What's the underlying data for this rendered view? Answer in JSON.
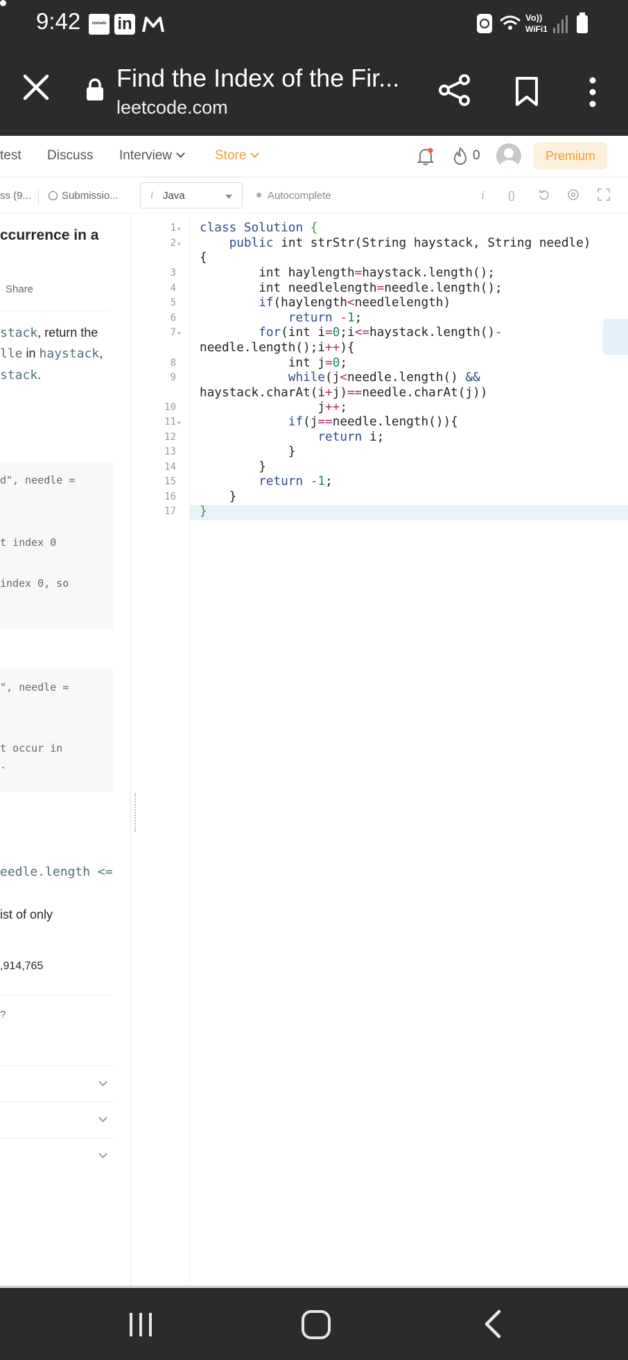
{
  "status_bar": {
    "time": "9:42",
    "zomato_label": "zomato",
    "linkedin_label": "in",
    "signal_label_1": "Vo))",
    "signal_label_2": "WiFi1"
  },
  "browser": {
    "title": "Find the Index of the Fir...",
    "url": "leetcode.com"
  },
  "nav": {
    "contest": "test",
    "discuss": "Discuss",
    "interview": "Interview",
    "store": "Store",
    "fire_count": "0",
    "premium": "Premium"
  },
  "tabs": {
    "solutions": "ss (9...",
    "submissions": "Submissio...",
    "language": "Java",
    "autocomplete": "Autocomplete",
    "info_glyph": "i",
    "braces_glyph": "{}"
  },
  "problem": {
    "title": "ccurrence in a",
    "share": "Share",
    "desc_1_code": "stack",
    "desc_1_text": ", return the",
    "desc_2_code_a": "lle",
    "desc_2_text": " in ",
    "desc_2_code_b": "haystack",
    "desc_2_tail": ",",
    "desc_3_code": "stack",
    "desc_3_tail": ".",
    "example_1": [
      "d\", needle =",
      "t index 0",
      "index 0, so"
    ],
    "example_2": [
      "\", needle =",
      "t occur in",
      "."
    ],
    "constraint_1": "eedle.length <=",
    "constraint_2": "ist of only",
    "stats": ",914,765",
    "similar": "?"
  },
  "editor": {
    "line_numbers": [
      "1",
      "2",
      "3",
      "4",
      "5",
      "6",
      "7",
      "8",
      "9",
      "10",
      "11",
      "12",
      "13",
      "14",
      "15",
      "16",
      "17"
    ]
  },
  "colors": {
    "system_bar": "#2b2b2b",
    "store_accent": "#e8a33b",
    "premium_bg": "#fdf0dd",
    "keyword": "#2f4a8e",
    "operator": "#b02a75"
  }
}
